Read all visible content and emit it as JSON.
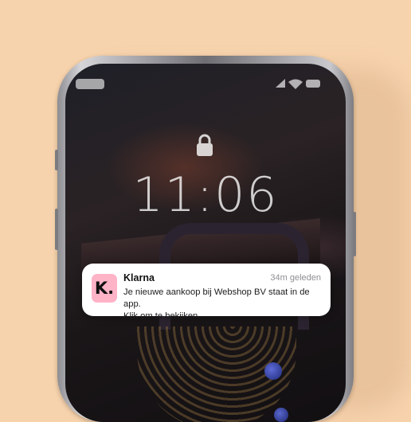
{
  "status_bar": {
    "signal_icon": "signal-icon",
    "wifi_icon": "wifi-icon",
    "battery_icon": "battery-icon"
  },
  "lock_screen": {
    "lock_icon": "lock-icon",
    "time": "11:06"
  },
  "notification": {
    "app_icon_label": "K.",
    "app_name": "Klarna",
    "timestamp": "34m geleden",
    "message_line1": "Je nieuwe aankoop bij Webshop BV staat in de app.",
    "message_line2": "Klik om te bekijken.",
    "icon_color": "#ffb3c7"
  },
  "background_color": "#f7d3ad"
}
